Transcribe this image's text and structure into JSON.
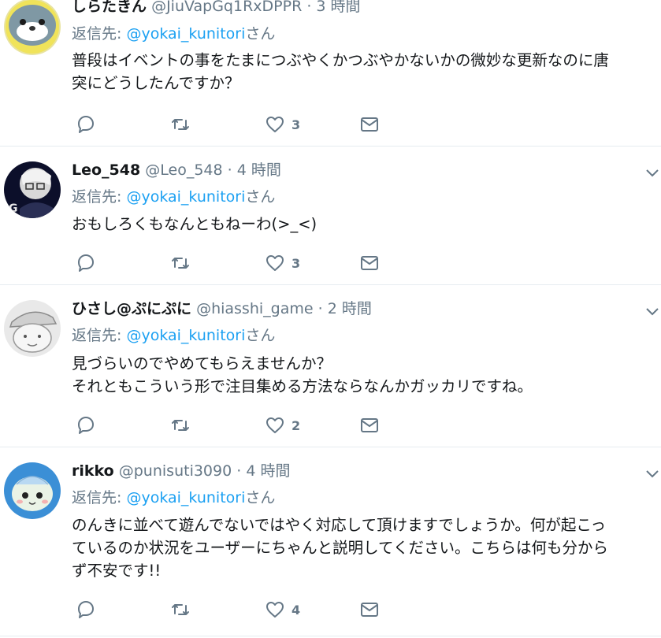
{
  "tweets": [
    {
      "name": "しらたきん",
      "handle": "@JiuVapGq1RxDPPR",
      "sep": "·",
      "time": "3 時間",
      "reply_prefix": "返信先: ",
      "reply_mention": "@yokai_kunitori",
      "reply_suffix": "さん",
      "lines": [
        "普段はイベントの事をたまにつぶやくかつぶやかないかの微妙な更新なのに唐",
        "突にどうしたんですか？"
      ],
      "likes": "3",
      "avatar": "seal-avatar"
    },
    {
      "name": "Leo_548",
      "handle": "@Leo_548",
      "sep": "·",
      "time": "4 時間",
      "reply_prefix": "返信先: ",
      "reply_mention": "@yokai_kunitori",
      "reply_suffix": "さん",
      "lines": [
        "おもしろくもなんともねーわ(>_<)"
      ],
      "likes": "3",
      "avatar": "dark-character-avatar"
    },
    {
      "name": "ひさし@ぷにぷに",
      "handle": "@hiasshi_game",
      "sep": "·",
      "time": "2 時間",
      "reply_prefix": "返信先: ",
      "reply_mention": "@yokai_kunitori",
      "reply_suffix": "さん",
      "lines": [
        "見づらいのでやめてもらえませんか？",
        "それともこういう形で注目集める方法ならなんかガッカリですね。"
      ],
      "likes": "2",
      "avatar": "sketch-face-avatar"
    },
    {
      "name": "rikko",
      "handle": "@punisuti3090",
      "sep": "·",
      "time": "4 時間",
      "reply_prefix": "返信先: ",
      "reply_mention": "@yokai_kunitori",
      "reply_suffix": "さん",
      "lines": [
        "のんきに並べて遊んでないではやく対応して頂けますでしょうか。何が起こっ",
        "ているのか状況をユーザーにちゃんと説明してください。こちらは何も分から",
        "ず不安です!!"
      ],
      "likes": "4",
      "avatar": "cute-blob-avatar"
    }
  ],
  "colors": {
    "link": "#1da1f2",
    "muted": "#657786",
    "text": "#14171a",
    "divider": "#e6ecf0"
  },
  "icons": [
    "reply-icon",
    "retweet-icon",
    "like-icon",
    "dm-icon",
    "chevron-down-icon"
  ]
}
